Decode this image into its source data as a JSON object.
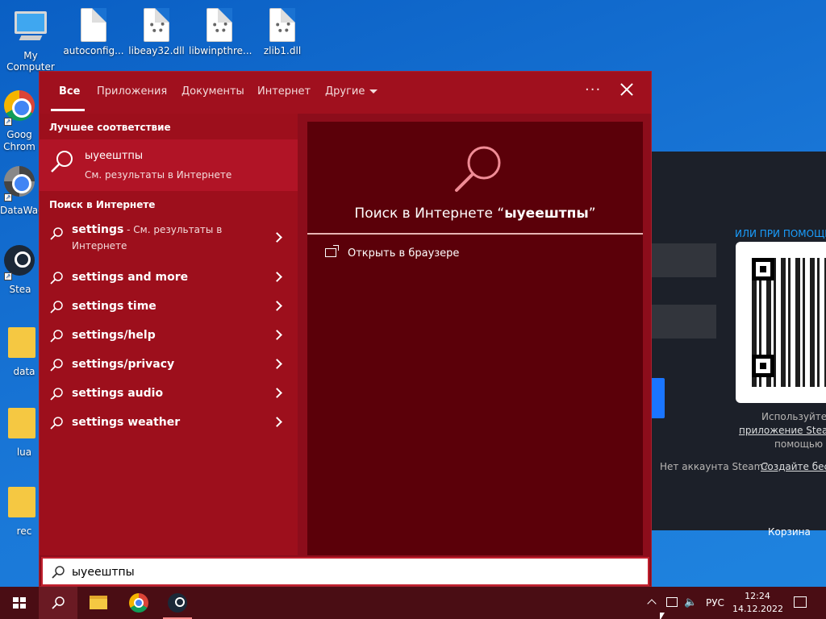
{
  "desktop_icons": [
    {
      "label": "My Computer",
      "icon": "computer-icon"
    },
    {
      "label": "autoconfig...",
      "icon": "file-icon"
    },
    {
      "label": "libeay32.dll",
      "icon": "dll-file-icon"
    },
    {
      "label": "libwinpthre...",
      "icon": "dll-file-icon"
    },
    {
      "label": "zlib1.dll",
      "icon": "dll-file-icon"
    },
    {
      "label": "Goog Chrom",
      "icon": "chrome-icon"
    },
    {
      "label": "DataWag",
      "icon": "app-icon"
    },
    {
      "label": "Stea",
      "icon": "steam-icon"
    },
    {
      "label": "data",
      "icon": "folder-icon"
    },
    {
      "label": "lua",
      "icon": "folder-icon"
    },
    {
      "label": "rec",
      "icon": "folder-icon"
    }
  ],
  "steam_window": {
    "qr_heading": "ИЛИ ПРИ ПОМОЩИ",
    "use_text": "Используйте м",
    "app_link": "приложение Steam",
    "help_text": "помощью Q",
    "no_account": "Нет аккаунта Steam?",
    "create_link": "Создайте бесп",
    "cart": "Корзина"
  },
  "search": {
    "tabs": [
      {
        "label": "Все",
        "active": true
      },
      {
        "label": "Приложения"
      },
      {
        "label": "Документы"
      },
      {
        "label": "Интернет"
      },
      {
        "label": "Другие"
      }
    ],
    "more_label": "···",
    "best_match_header": "Лучшее соответствие",
    "best_match": {
      "title": "ыуеештпы",
      "subtitle": "См. результаты в Интернете"
    },
    "web_header": "Поиск в Интернете",
    "suggestions": [
      {
        "bold": "settings",
        "suffix": " - См. результаты в Интернете"
      },
      {
        "bold": "settings and more",
        "suffix": ""
      },
      {
        "bold": "settings time",
        "suffix": ""
      },
      {
        "bold": "settings/help",
        "suffix": ""
      },
      {
        "bold": "settings/privacy",
        "suffix": ""
      },
      {
        "bold": "settings audio",
        "suffix": ""
      },
      {
        "bold": "settings weather",
        "suffix": ""
      }
    ],
    "preview": {
      "title_prefix": "Поиск в Интернете “",
      "query": "ыуеештпы",
      "title_suffix": "”",
      "open_browser": "Открыть в браузере"
    },
    "query_value": "ыуеештпы"
  },
  "taskbar": {
    "lang": "РУС",
    "time": "12:24",
    "date": "14.12.2022"
  },
  "colors": {
    "accent": "#a0101e",
    "preview_bg": "#5b0009",
    "desktop": "#1a78d8"
  }
}
